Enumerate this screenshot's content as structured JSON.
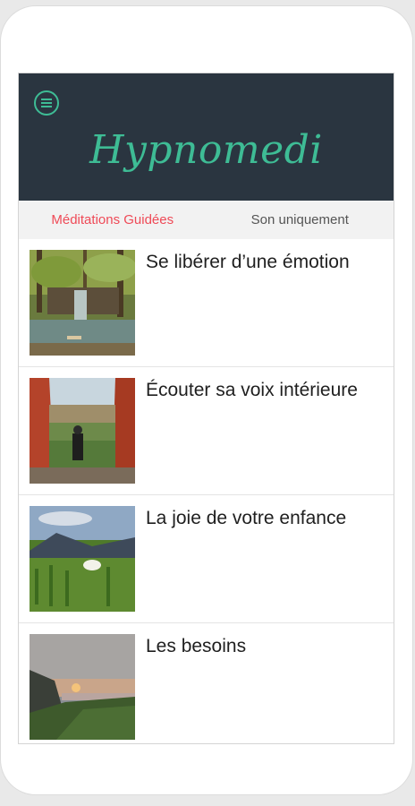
{
  "app": {
    "title": "Hypnomedi",
    "accent_color": "#3ebc95",
    "header_color": "#2a3540",
    "active_tab_color": "#ef4a57"
  },
  "header": {
    "menu_icon": "menu-icon"
  },
  "tabs": [
    {
      "label": "Méditations Guidées",
      "active": true
    },
    {
      "label": "Son uniquement",
      "active": false
    }
  ],
  "meditations": [
    {
      "title": "Se libérer d’une émotion",
      "image": "forest-waterfall-photo"
    },
    {
      "title": "Écouter sa voix intérieure",
      "image": "canyon-hiker-photo"
    },
    {
      "title": "La joie de votre enfance",
      "image": "meadow-flowers-photo"
    },
    {
      "title": "Les besoins",
      "image": "coastal-sunset-photo"
    }
  ]
}
